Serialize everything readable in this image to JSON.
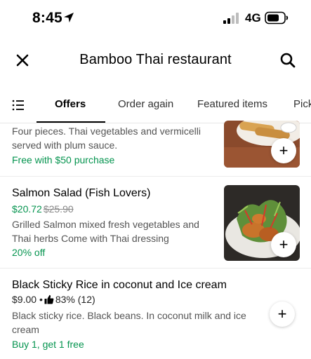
{
  "status_bar": {
    "time": "8:45",
    "network": "4G"
  },
  "header": {
    "title": "Bamboo Thai restaurant"
  },
  "tabs": [
    {
      "label": "Offers",
      "active": true
    },
    {
      "label": "Order again",
      "active": false
    },
    {
      "label": "Featured items",
      "active": false
    },
    {
      "label": "Pick",
      "active": false
    }
  ],
  "items": [
    {
      "description": "Four pieces. Thai vegetables and vermicelli served with plum sauce.",
      "promo": "Free with $50 purchase",
      "add_label": "+"
    },
    {
      "title": "Salmon Salad (Fish Lovers)",
      "price_sale": "$20.72",
      "price_old": "$25.90",
      "description": "Grilled Salmon mixed  fresh vegetables and Thai herbs   Come with   Thai dressing",
      "promo": "20% off",
      "add_label": "+"
    },
    {
      "title": "Black Sticky Rice in coconut  and Ice cream",
      "price": "$9.00",
      "separator": "•",
      "rating": "83% (12)",
      "description": "Black sticky rice. Black beans. In coconut milk and ice cream",
      "promo": "Buy 1, get 1 free",
      "add_label": "+"
    }
  ],
  "colors": {
    "promo_green": "#05944f",
    "text_secondary": "#545454"
  }
}
